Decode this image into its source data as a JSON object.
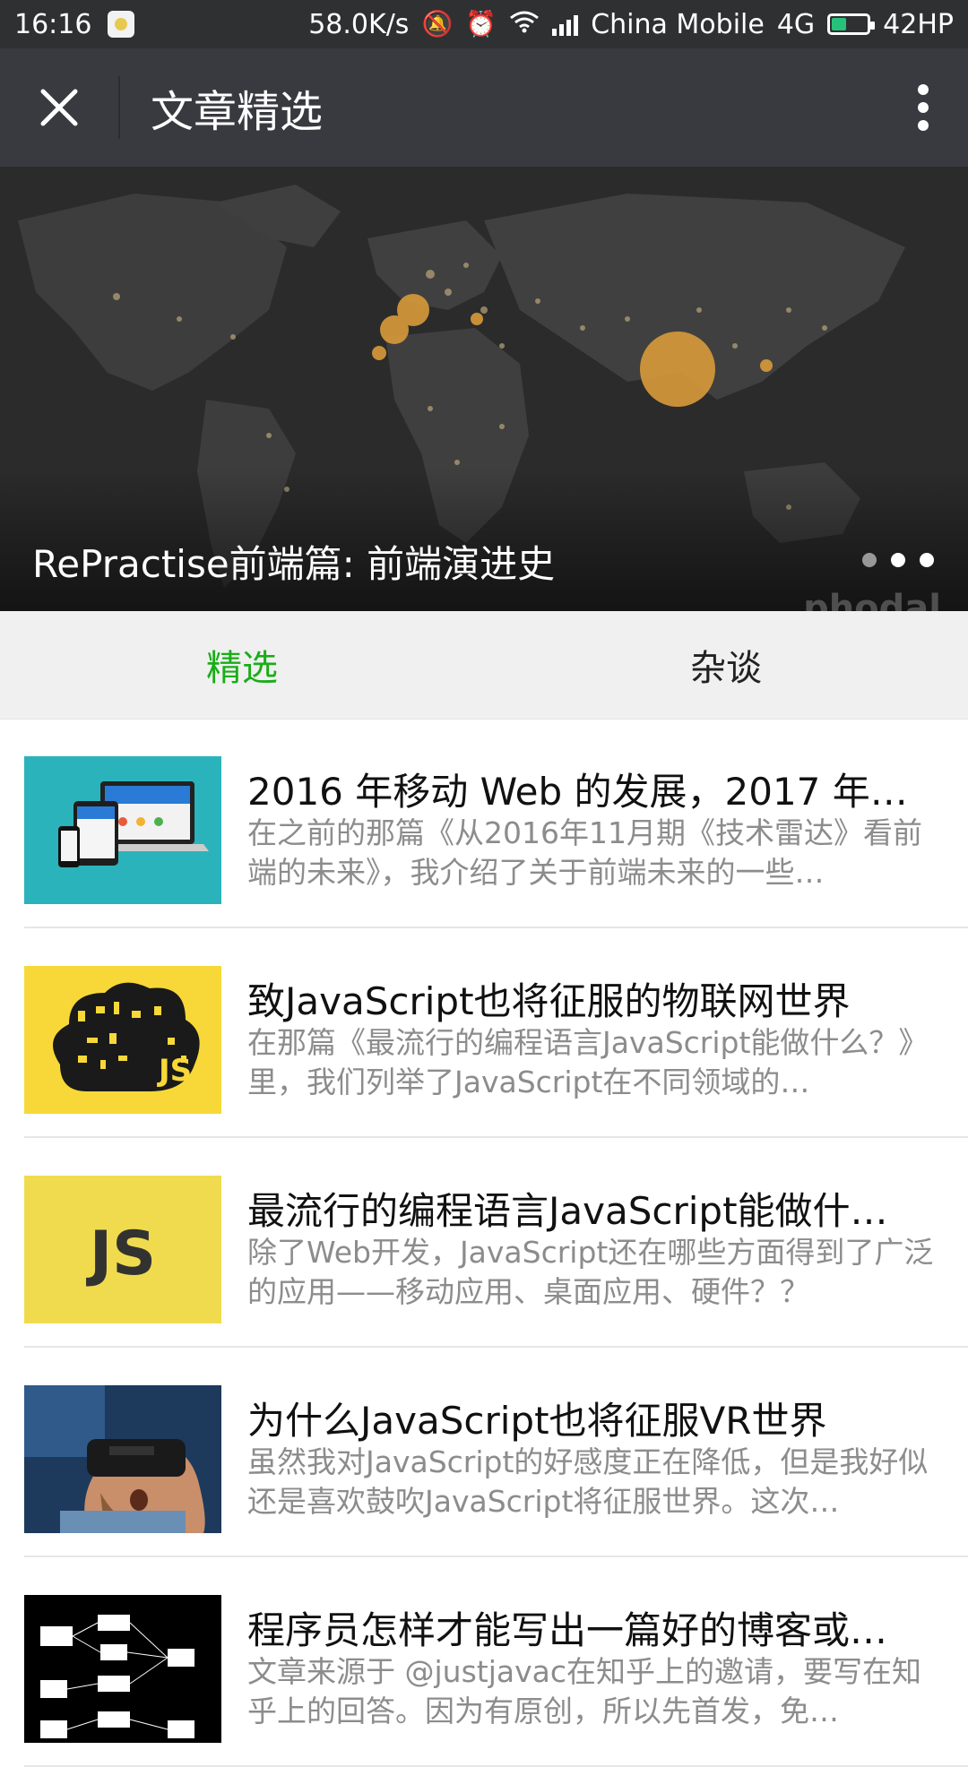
{
  "status_bar": {
    "time": "16:16",
    "net_speed": "58.0K/s",
    "carrier": "China Mobile",
    "network": "4G",
    "battery_text": "42HP",
    "battery_level": 0.42
  },
  "header": {
    "title": "文章精选"
  },
  "banner": {
    "title": "RePractise前端篇: 前端演进史",
    "watermark": "phodal",
    "page_count": 3,
    "active_page": 3
  },
  "tabs": [
    {
      "label": "精选",
      "active": true
    },
    {
      "label": "杂谈",
      "active": false
    }
  ],
  "articles": [
    {
      "title": "2016 年移动 Web 的发展，2017 年的…",
      "desc": "在之前的那篇《从2016年11月期《技术雷达》看前端的未来》，我介绍了关于前端未来的一些…",
      "thumb": "devices"
    },
    {
      "title": "致JavaScript也将征服的物联网世界",
      "desc": "在那篇《最流行的编程语言JavaScript能做什么？》里，我们列举了JavaScript在不同领域的…",
      "thumb": "js-cloud"
    },
    {
      "title": "最流行的编程语言JavaScript能做什…",
      "desc": "除了Web开发，JavaScript还在哪些方面得到了广泛的应用——移动应用、桌面应用、硬件？？",
      "thumb": "js-logo"
    },
    {
      "title": "为什么JavaScript也将征服VR世界",
      "desc": "虽然我对JavaScript的好感度正在降低，但是我好似还是喜欢鼓吹JavaScript将征服世界。这次…",
      "thumb": "vr"
    },
    {
      "title": "程序员怎样才能写出一篇好的博客或…",
      "desc": "文章来源于 @justjavac在知乎上的邀请，要写在知乎上的回答。因为有原创，所以先首发，免…",
      "thumb": "diagram"
    }
  ],
  "colors": {
    "status_bg": "#2f3032",
    "title_bg": "#393a3f",
    "tab_active": "#1aad19",
    "desc_text": "#8c8c8c"
  }
}
